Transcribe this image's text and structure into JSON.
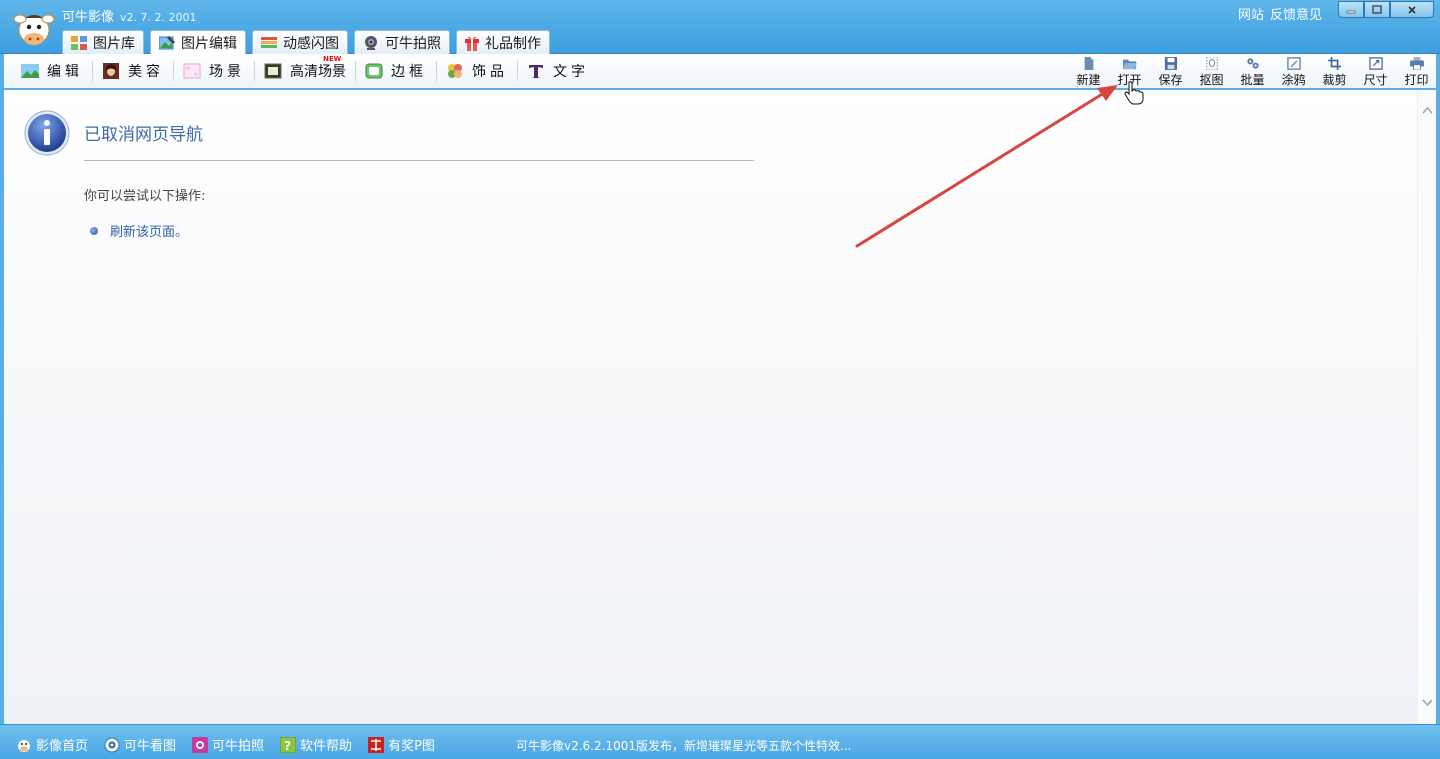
{
  "window": {
    "app_name": "可牛影像",
    "version": "v2. 7. 2. 2001",
    "links": [
      "网站",
      "反馈意见"
    ]
  },
  "main_tabs": [
    {
      "label": "图片库",
      "icon": "gallery-icon"
    },
    {
      "label": "图片编辑",
      "icon": "edit-image-icon",
      "active": true
    },
    {
      "label": "动感闪图",
      "icon": "animated-icon"
    },
    {
      "label": "可牛拍照",
      "icon": "camera-icon"
    },
    {
      "label": "礼品制作",
      "icon": "gift-icon"
    }
  ],
  "sub_tabs": [
    {
      "label": "编辑",
      "icon": "landscape-icon"
    },
    {
      "label": "美容",
      "icon": "portrait-icon"
    },
    {
      "label": "场景",
      "icon": "scene-icon"
    },
    {
      "label": "高清场景",
      "icon": "hd-scene-icon",
      "badge": "NEW"
    },
    {
      "label": "边框",
      "icon": "frame-icon"
    },
    {
      "label": "饰品",
      "icon": "clover-icon"
    },
    {
      "label": "文字",
      "icon": "text-icon"
    }
  ],
  "tools": [
    {
      "label": "新建",
      "icon": "new-file-icon"
    },
    {
      "label": "打开",
      "icon": "open-folder-icon"
    },
    {
      "label": "保存",
      "icon": "save-icon"
    },
    {
      "label": "抠图",
      "icon": "cutout-icon"
    },
    {
      "label": "批量",
      "icon": "batch-gear-icon"
    },
    {
      "label": "涂鸦",
      "icon": "doodle-icon"
    },
    {
      "label": "裁剪",
      "icon": "crop-icon"
    },
    {
      "label": "尺寸",
      "icon": "resize-icon"
    },
    {
      "label": "打印",
      "icon": "print-icon"
    }
  ],
  "content": {
    "title": "已取消网页导航",
    "subtitle": "你可以尝试以下操作:",
    "action": "刷新该页面。"
  },
  "status_bar": {
    "links": [
      {
        "label": "影像首页",
        "icon": "cow-home-icon"
      },
      {
        "label": "可牛看图",
        "icon": "eye-icon"
      },
      {
        "label": "可牛拍照",
        "icon": "photo-icon"
      },
      {
        "label": "软件帮助",
        "icon": "help-icon"
      },
      {
        "label": "有奖P图",
        "icon": "prize-icon"
      }
    ],
    "news": "可牛影像v2.6.2.1001版发布，新增璀璨星光等五款个性特效..."
  },
  "colors": {
    "accent": "#4aa6e4",
    "title_text": "#3f6aa6",
    "arrow": "#d9443f"
  }
}
